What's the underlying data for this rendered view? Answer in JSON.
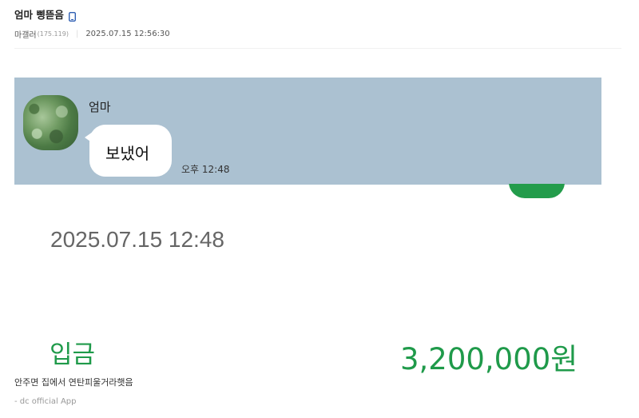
{
  "post": {
    "title": "엄마 삥뜯음",
    "author": "마갤러",
    "author_ip": "(175.119)",
    "meta_separator": "|",
    "date": "2025.07.15 12:56:30",
    "body": "안주면 집에서 연탄피울거라햇음",
    "footer": "- dc official App"
  },
  "chat": {
    "sender": "엄마",
    "message": "보냈어",
    "time": "오후 12:48"
  },
  "transaction": {
    "datetime": "2025.07.15 12:48",
    "type": "입금",
    "amount": "3,200,000원"
  },
  "colors": {
    "chat_background": "#abc1d1",
    "bank_green": "#1f9a4a",
    "mobile_icon": "#2f5fb3"
  },
  "icons": {
    "title_icon": "mobile-phone-icon"
  }
}
